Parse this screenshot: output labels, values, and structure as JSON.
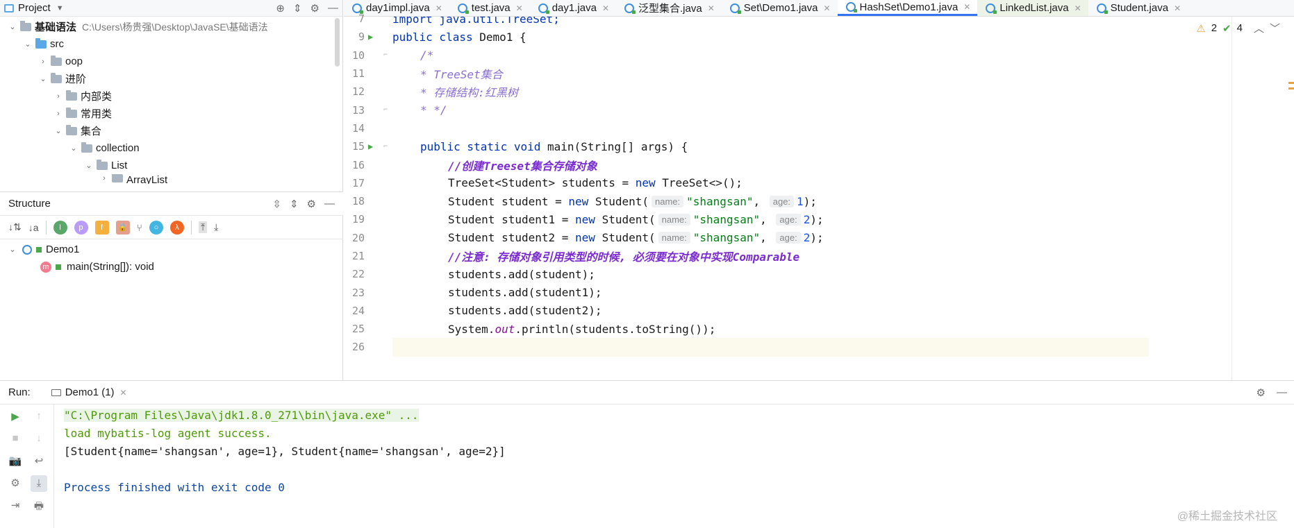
{
  "project_panel": {
    "title": "Project",
    "tree": [
      {
        "label": "基础语法",
        "path": "C:\\Users\\杨贵强\\Desktop\\JavaSE\\基础语法"
      },
      {
        "label": "src"
      },
      {
        "label": "oop"
      },
      {
        "label": "进阶"
      },
      {
        "label": "内部类"
      },
      {
        "label": "常用类"
      },
      {
        "label": "集合"
      },
      {
        "label": "collection"
      },
      {
        "label": "List"
      },
      {
        "label": "ArrayList"
      }
    ]
  },
  "structure_panel": {
    "title": "Structure",
    "items": [
      {
        "label": "Demo1"
      },
      {
        "label": "main(String[]): void"
      }
    ]
  },
  "editor": {
    "tabs": [
      {
        "label": "day1impl.java"
      },
      {
        "label": "test.java"
      },
      {
        "label": "day1.java"
      },
      {
        "label": "泛型集合.java"
      },
      {
        "label": "Set\\Demo1.java"
      },
      {
        "label": "HashSet\\Demo1.java"
      },
      {
        "label": "LinkedList.java"
      },
      {
        "label": "Student.java"
      }
    ],
    "inspections": {
      "warnings": "2",
      "ok": "4"
    },
    "line_numbers": [
      "7",
      "9",
      "10",
      "11",
      "12",
      "13",
      "14",
      "15",
      "16",
      "17",
      "18",
      "19",
      "20",
      "21",
      "22",
      "23",
      "24",
      "25",
      "26"
    ],
    "code": {
      "l7": "import java.util.TreeSet;",
      "l9_kw": "public class",
      "l9_rest": " Demo1 {",
      "l10": "/*",
      "l11": "* TreeSet集合",
      "l12": "* 存储结构:红黑树",
      "l13": "* */",
      "l15_kw": "public static void",
      "l15_rest": " main(String[] args) {",
      "l16": "//创建Treeset集合存储对象",
      "l17_a": "TreeSet<Student> students = ",
      "l17_kw": "new",
      "l17_b": " TreeSet<>();",
      "l18_a": "Student student = ",
      "l18_kw": "new",
      "l18_b": " Student(",
      "hint_name": "name:",
      "hint_age": "age:",
      "l18_str": "\"shangsan\"",
      "l18_num": "1",
      "end": ");",
      "l19_a": "Student student1 = ",
      "l19_str": "\"shangsan\"",
      "l19_num": "2",
      "l20_a": "Student student2 = ",
      "l20_str": "\"shangsan\"",
      "l20_num": "2",
      "l21": "//注意: 存储对象引用类型的时候, 必须要在对象中实现Comparable",
      "l22": "students.add(student);",
      "l23": "students.add(student1);",
      "l24": "students.add(student2);",
      "l25_a": "System.",
      "l25_out": "out",
      "l25_b": ".println(students.toString());"
    }
  },
  "run_panel": {
    "label": "Run:",
    "tab": "Demo1 (1)",
    "console": [
      "\"C:\\Program Files\\Java\\jdk1.8.0_271\\bin\\java.exe\" ...",
      "load mybatis-log agent success.",
      "[Student{name='shangsan', age=1}, Student{name='shangsan', age=2}]",
      "",
      "Process finished with exit code 0"
    ]
  },
  "watermark": "@稀土掘金技术社区"
}
